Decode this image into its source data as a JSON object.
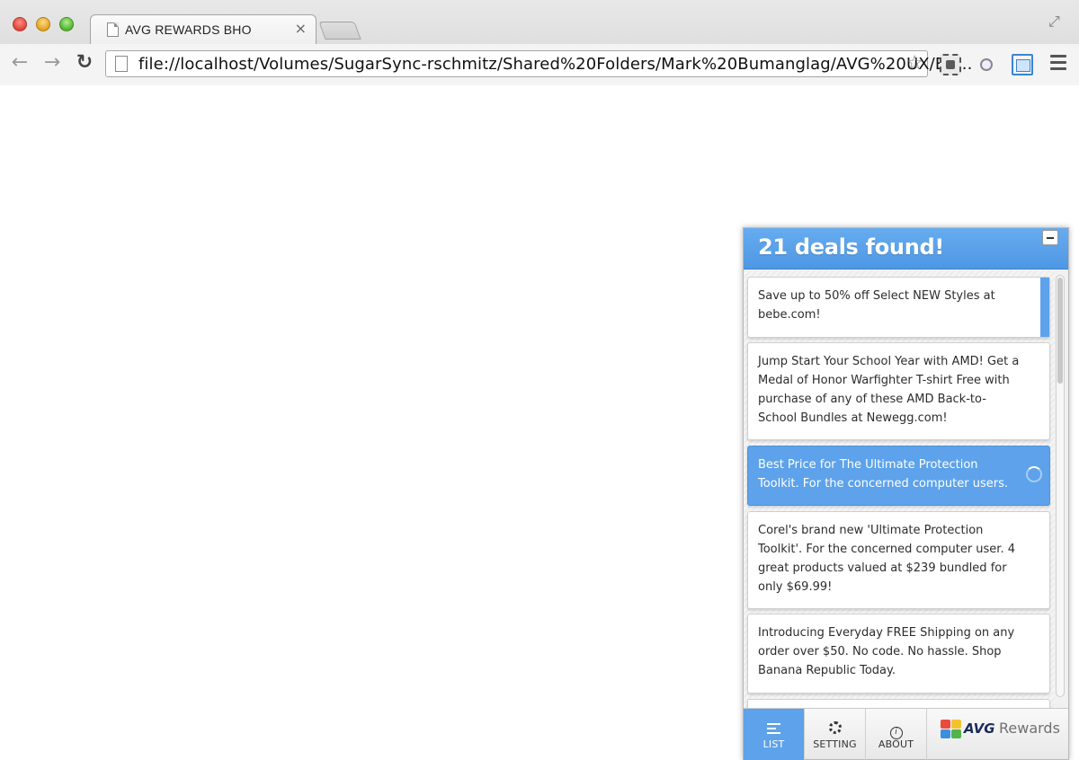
{
  "browser": {
    "tab_title": "AVG REWARDS BHO",
    "tab_close": "×",
    "url": "file://localhost/Volumes/SugarSync-rschmitz/Shared%20Folders/Mark%20Bumanglag/AVG%20UX/EC...",
    "back_glyph": "←",
    "forward_glyph": "→",
    "reload_glyph": "↻",
    "star_glyph": "☆",
    "fullscreen_glyph": "⤢"
  },
  "panel": {
    "title": "21 deals found!",
    "deals": [
      {
        "text": "Save up to 50% off Select NEW Styles at bebe.com!"
      },
      {
        "text": "Jump Start Your School Year with AMD! Get a Medal of Honor Warfighter T-shirt Free with purchase of any of these AMD Back-to-School Bundles at Newegg.com!"
      },
      {
        "text": "Best Price for The Ultimate Protection Toolkit. For the concerned computer users."
      },
      {
        "text": "Corel's brand new 'Ultimate Protection Toolkit'. For the concerned computer user. 4 great products valued at $239 bundled for only $69.99!"
      },
      {
        "text": "Introducing Everyday FREE Shipping on any order over $50. No code. No hassle. Shop Banana Republic Today."
      }
    ],
    "footer": {
      "list_label": "LIST",
      "setting_label": "SETTING",
      "about_label": "ABOUT",
      "about_glyph": "i",
      "brand_name": "AVG",
      "brand_suffix": "Rewards"
    }
  },
  "colors": {
    "accent": "#5da2ea",
    "header_top": "#66acf0"
  }
}
